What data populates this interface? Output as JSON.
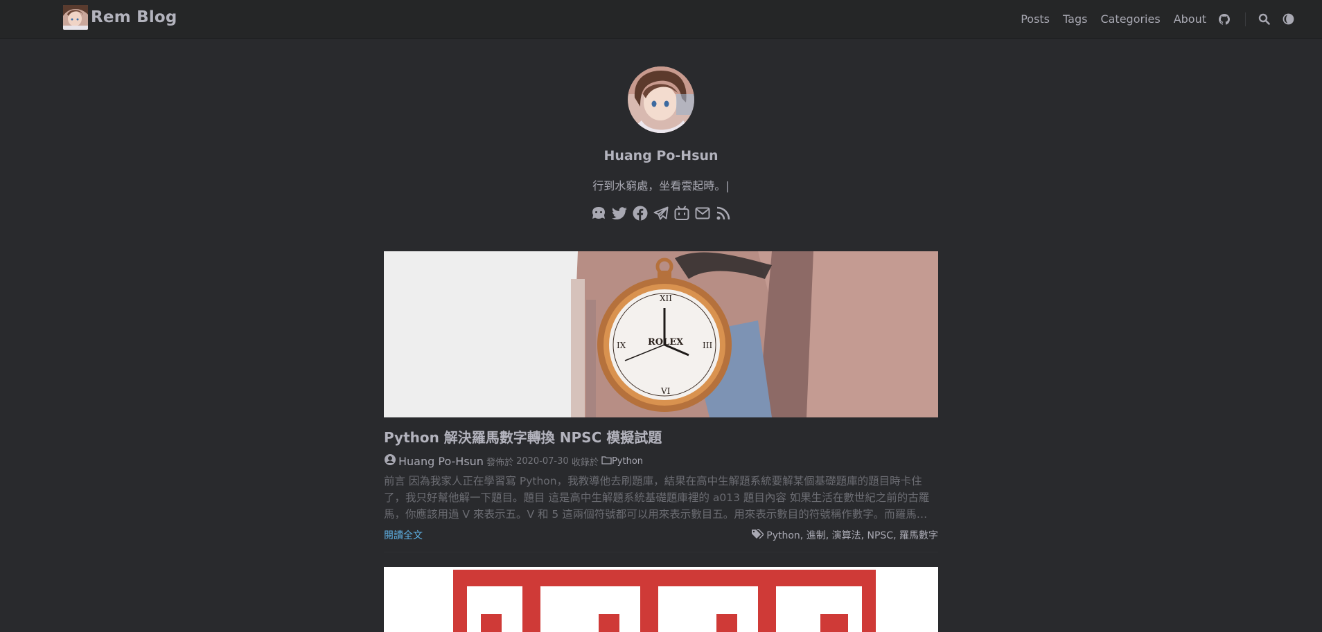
{
  "site": {
    "title": "Rem Blog"
  },
  "nav": {
    "items": [
      "Posts",
      "Tags",
      "Categories",
      "About"
    ],
    "icons": [
      "github-icon",
      "search-icon",
      "theme-toggle-icon"
    ]
  },
  "profile": {
    "name": "Huang Po-Hsun",
    "subtitle": "行到水窮處，坐看雲起時。|",
    "social_icons": [
      "github-icon",
      "twitter-icon",
      "facebook-icon",
      "telegram-icon",
      "bilibili-icon",
      "email-icon",
      "rss-icon"
    ]
  },
  "posts": [
    {
      "title": "Python 解決羅馬數字轉換 NPSC 模擬試題",
      "author": "Huang Po-Hsun",
      "published_label": "發佈於",
      "date": "2020-07-30",
      "category_label": "收錄於",
      "category": "Python",
      "excerpt": "前言 因為我家人正在學習寫 Python，我教導他去刷題庫，結果在高中生解題系統要解某個基礎題庫的題目時卡住了，我只好幫他解一下題目。題目 這是高中生解題系統基礎題庫裡的 a013 題目內容 如果生活在數世紀之前的古羅馬，你應該用過 V 來表示五。V 和 5 這兩個符號都可以用來表示數目五。用來表示數目的符號稱作數字。而羅馬…",
      "read_more": "閱讀全文",
      "tags": "Python, 進制, 演算法, NPSC, 羅馬數字"
    }
  ],
  "colors": {
    "background": "#292a2d",
    "header": "#252627",
    "link": "#5fb2e6",
    "text": "#a9a9b3"
  }
}
